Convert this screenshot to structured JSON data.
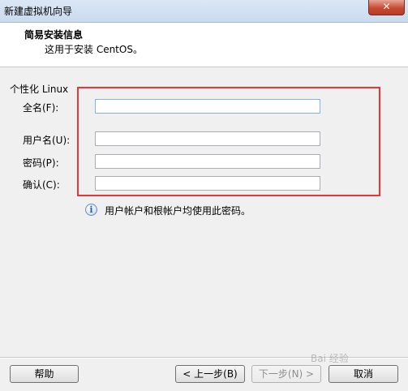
{
  "window": {
    "title": "新建虚拟机向导",
    "close_label": "✕"
  },
  "header": {
    "title": "简易安装信息",
    "subtitle": "这用于安装 CentOS。"
  },
  "group": {
    "label": "个性化 Linux"
  },
  "fields": {
    "fullname": {
      "label": "全名(F):",
      "value": ""
    },
    "username": {
      "label": "用户名(U):",
      "value": ""
    },
    "password": {
      "label": "密码(P):",
      "value": ""
    },
    "confirm": {
      "label": "确认(C):",
      "value": ""
    }
  },
  "info": {
    "icon": "info-icon",
    "text": "用户帐户和根帐户均使用此密码。"
  },
  "buttons": {
    "help": "帮助",
    "back": "< 上一步(B)",
    "next": "下一步(N) >",
    "cancel": "取消"
  },
  "watermark": "Bai 经验",
  "colors": {
    "highlight_box": "#e8363a",
    "focus_border": "#7eb4ea"
  }
}
